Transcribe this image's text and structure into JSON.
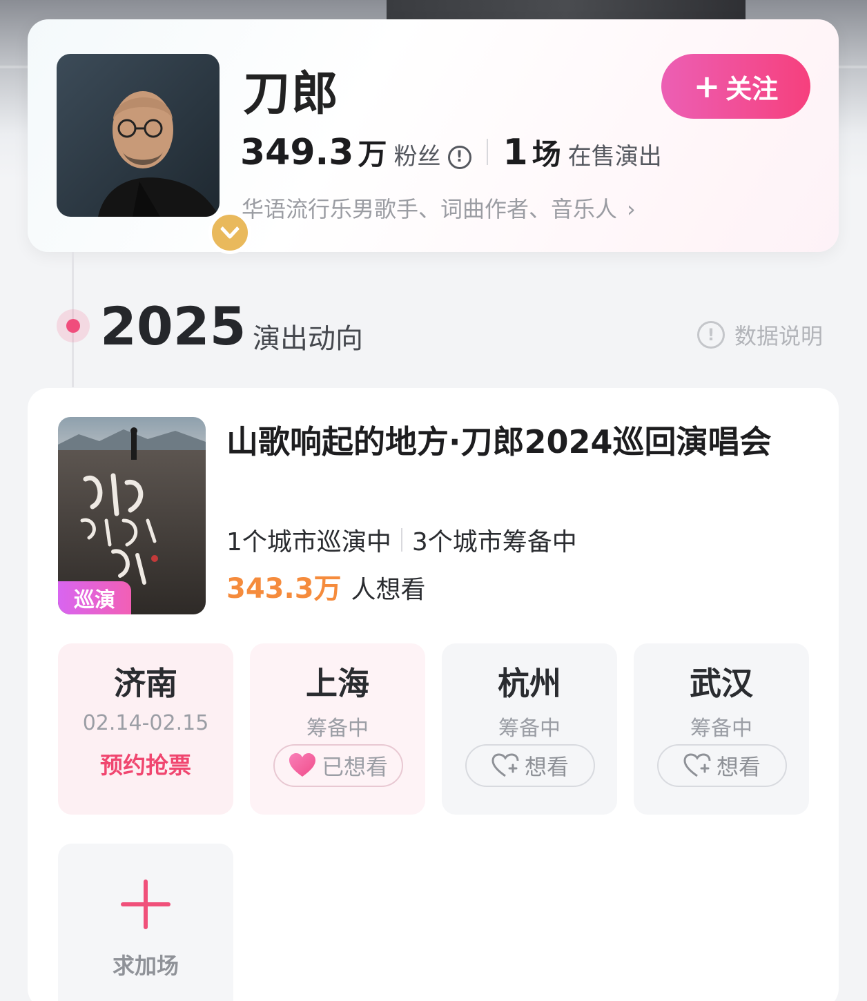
{
  "artist": {
    "name": "刀郎",
    "follow_label": "关注",
    "fans_count": "349.3",
    "fans_unit": "万",
    "fans_label": "粉丝",
    "shows_count": "1",
    "shows_unit": "场",
    "shows_label": "在售演出",
    "description": "华语流行乐男歌手、词曲作者、音乐人"
  },
  "section": {
    "year": "2025",
    "label": "演出动向",
    "data_info": "数据说明"
  },
  "tour": {
    "title": "山歌响起的地方·刀郎2024巡回演唱会",
    "tag": "巡演",
    "cities_touring": "1个城市巡演中",
    "cities_planning": "3个城市筹备中",
    "want_count": "343.3万",
    "want_label": "人想看",
    "cities": [
      {
        "name": "济南",
        "status": "02.14-02.15",
        "action": "预约抢票"
      },
      {
        "name": "上海",
        "status": "筹备中",
        "action": "已想看"
      },
      {
        "name": "杭州",
        "status": "筹备中",
        "action": "想看"
      },
      {
        "name": "武汉",
        "status": "筹备中",
        "action": "想看"
      }
    ],
    "request_label": "求加场"
  },
  "colors": {
    "accent": "#f0466f",
    "follow_gradient_start": "#ec5fb4",
    "follow_gradient_end": "#f6407d",
    "want_count": "#f58b3c",
    "verified_badge": "#e9b95c"
  }
}
